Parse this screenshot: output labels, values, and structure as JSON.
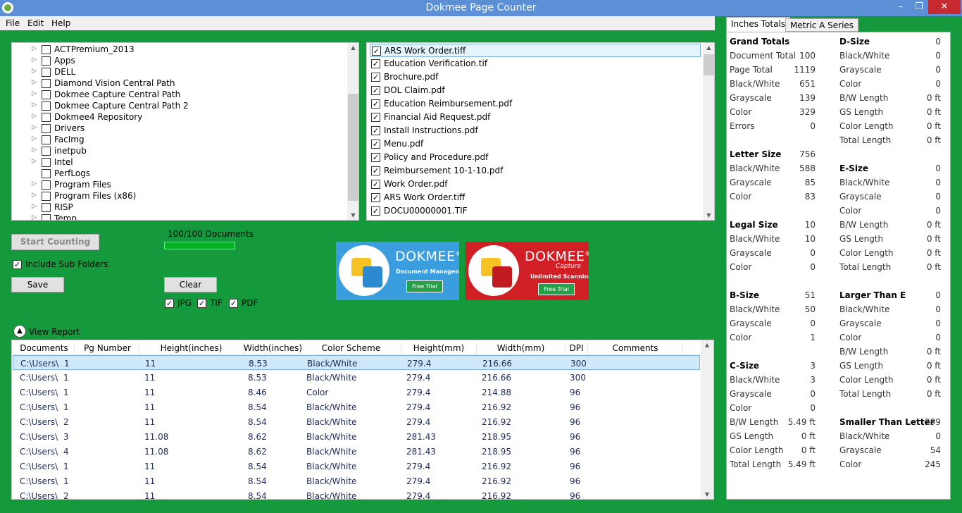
{
  "window": {
    "title": "Dokmee Page Counter",
    "minimize": "–",
    "maximize": "❐",
    "close": "✕"
  },
  "menu": [
    "File",
    "Edit",
    "Help"
  ],
  "folders": [
    "ACTPremium_2013",
    "Apps",
    "DELL",
    "Diamond Vision Central Path",
    "Dokmee Capture Central Path",
    "Dokmee Capture Central Path 2",
    "Dokmee4 Repository",
    "Drivers",
    "FacImg",
    "inetpub",
    "Intel",
    "PerfLogs",
    "Program Files",
    "Program Files (x86)",
    "RISP",
    "Temp"
  ],
  "files": [
    "ARS Work Order.tiff",
    "Education Verification.tif",
    "Brochure.pdf",
    "DOL Claim.pdf",
    "Education Reimbursement.pdf",
    "Financial Aid Request.pdf",
    "Install Instructions.pdf",
    "Menu.pdf",
    "Policy and Procedure.pdf",
    "Reimbursement 10-1-10.pdf",
    "Work Order.pdf",
    "ARS Work Order.tiff",
    "DOCU00000001.TIF"
  ],
  "controls": {
    "start_counting": "Start Counting",
    "progress_text": "100/100 Documents",
    "progress_value": 1.0,
    "include_sub": "Include Sub Folders",
    "save": "Save",
    "clear": "Clear",
    "jpg": "JPG",
    "tif": "TIF",
    "pdf": "PDF",
    "view_report": "View Report"
  },
  "promos": [
    {
      "brand": "DOKMEE",
      "reg": "®",
      "line1": "Document Management",
      "trial": "Free Trial",
      "color": "#3a9ddd"
    },
    {
      "brand": "DOKMEE",
      "reg": "®",
      "tag": "Capture",
      "line1": "Unlimited Scanning",
      "trial": "Free Trial",
      "color": "#d11f26"
    }
  ],
  "report": {
    "columns": [
      "Documents",
      "Pg Number",
      "Height(inches)",
      "Width(inches)",
      "Color Scheme",
      "Height(mm)",
      "Width(mm)",
      "DPI",
      "Comments"
    ],
    "rows": [
      [
        "C:\\Users\\",
        "1",
        "11",
        "8.53",
        "Black/White",
        "279.4",
        "216.66",
        "300",
        ""
      ],
      [
        "C:\\Users\\",
        "1",
        "11",
        "8.53",
        "Black/White",
        "279.4",
        "216.66",
        "300",
        ""
      ],
      [
        "C:\\Users\\",
        "1",
        "11",
        "8.46",
        "Color",
        "279.4",
        "214.88",
        "96",
        ""
      ],
      [
        "C:\\Users\\",
        "1",
        "11",
        "8.54",
        "Black/White",
        "279.4",
        "216.92",
        "96",
        ""
      ],
      [
        "C:\\Users\\",
        "2",
        "11",
        "8.54",
        "Black/White",
        "279.4",
        "216.92",
        "96",
        ""
      ],
      [
        "C:\\Users\\",
        "3",
        "11.08",
        "8.62",
        "Black/White",
        "281.43",
        "218.95",
        "96",
        ""
      ],
      [
        "C:\\Users\\",
        "4",
        "11.08",
        "8.62",
        "Black/White",
        "281.43",
        "218.95",
        "96",
        ""
      ],
      [
        "C:\\Users\\",
        "1",
        "11",
        "8.54",
        "Black/White",
        "279.4",
        "216.92",
        "96",
        ""
      ],
      [
        "C:\\Users\\",
        "1",
        "11",
        "8.54",
        "Black/White",
        "279.4",
        "216.92",
        "96",
        ""
      ],
      [
        "C:\\Users\\",
        "2",
        "11",
        "8.54",
        "Black/White",
        "279.4",
        "216.92",
        "96",
        ""
      ]
    ]
  },
  "tabs": [
    "Inches Totals",
    "Metric A Series"
  ],
  "stats_left": [
    {
      "label": "Grand Totals",
      "value": "",
      "h": true
    },
    {
      "label": "Document Total",
      "value": "100"
    },
    {
      "label": "Page Total",
      "value": "1119"
    },
    {
      "label": "Black/White",
      "value": "651"
    },
    {
      "label": "Grayscale",
      "value": "139"
    },
    {
      "label": "Color",
      "value": "329"
    },
    {
      "label": "Errors",
      "value": "0"
    },
    {
      "label": "",
      "value": ""
    },
    {
      "label": "Letter Size",
      "value": "756",
      "h": true
    },
    {
      "label": "Black/White",
      "value": "588"
    },
    {
      "label": "Grayscale",
      "value": "85"
    },
    {
      "label": "Color",
      "value": "83"
    },
    {
      "label": "",
      "value": ""
    },
    {
      "label": "Legal Size",
      "value": "10",
      "h": true
    },
    {
      "label": "Black/White",
      "value": "10"
    },
    {
      "label": "Grayscale",
      "value": "0"
    },
    {
      "label": "Color",
      "value": "0"
    },
    {
      "label": "",
      "value": ""
    },
    {
      "label": "B-Size",
      "value": "51",
      "h": true
    },
    {
      "label": "Black/White",
      "value": "50"
    },
    {
      "label": "Grayscale",
      "value": "0"
    },
    {
      "label": "Color",
      "value": "1"
    },
    {
      "label": "",
      "value": ""
    },
    {
      "label": "C-Size",
      "value": "3",
      "h": true
    },
    {
      "label": "Black/White",
      "value": "3"
    },
    {
      "label": "Grayscale",
      "value": "0"
    },
    {
      "label": "Color",
      "value": "0"
    },
    {
      "label": "B/W Length",
      "value": "5.49 ft"
    },
    {
      "label": "GS Length",
      "value": "0 ft"
    },
    {
      "label": "Color Length",
      "value": "0 ft"
    },
    {
      "label": "Total Length",
      "value": "5.49 ft"
    }
  ],
  "stats_right": [
    {
      "label": "D-Size",
      "value": "0",
      "h": true
    },
    {
      "label": "Black/White",
      "value": "0"
    },
    {
      "label": "Grayscale",
      "value": "0"
    },
    {
      "label": "Color",
      "value": "0"
    },
    {
      "label": "B/W Length",
      "value": "0 ft"
    },
    {
      "label": "GS Length",
      "value": "0 ft"
    },
    {
      "label": "Color Length",
      "value": "0 ft"
    },
    {
      "label": "Total Length",
      "value": "0 ft"
    },
    {
      "label": "",
      "value": ""
    },
    {
      "label": "E-Size",
      "value": "0",
      "h": true
    },
    {
      "label": "Black/White",
      "value": "0"
    },
    {
      "label": "Grayscale",
      "value": "0"
    },
    {
      "label": "Color",
      "value": "0"
    },
    {
      "label": "B/W Length",
      "value": "0 ft"
    },
    {
      "label": "GS Length",
      "value": "0 ft"
    },
    {
      "label": "Color Length",
      "value": "0 ft"
    },
    {
      "label": "Total Length",
      "value": "0 ft"
    },
    {
      "label": "",
      "value": ""
    },
    {
      "label": "Larger Than E",
      "value": "0",
      "h": true
    },
    {
      "label": "Black/White",
      "value": "0"
    },
    {
      "label": "Grayscale",
      "value": "0"
    },
    {
      "label": "Color",
      "value": "0"
    },
    {
      "label": "B/W Length",
      "value": "0 ft"
    },
    {
      "label": "GS Length",
      "value": "0 ft"
    },
    {
      "label": "Color Length",
      "value": "0 ft"
    },
    {
      "label": "Total Length",
      "value": "0 ft"
    },
    {
      "label": "",
      "value": ""
    },
    {
      "label": "Smaller Than Letter",
      "value": "299",
      "h": true
    },
    {
      "label": "Black/White",
      "value": "0"
    },
    {
      "label": "Grayscale",
      "value": "54"
    },
    {
      "label": "Color",
      "value": "245"
    }
  ]
}
